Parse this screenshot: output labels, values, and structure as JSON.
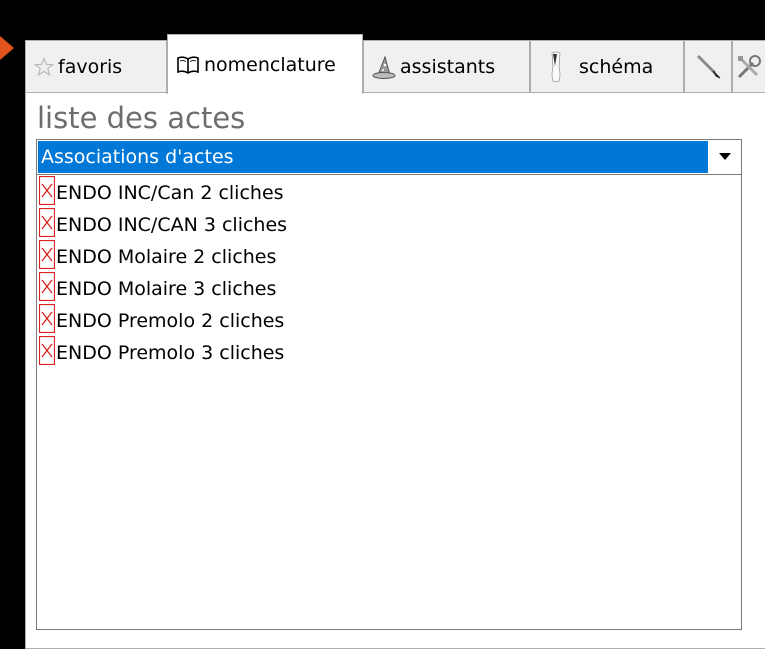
{
  "tabs": [
    {
      "label": "favoris",
      "icon": "star-icon"
    },
    {
      "label": "nomenclature",
      "icon": "book-icon",
      "active": true
    },
    {
      "label": "assistants",
      "icon": "wizard-hat-icon"
    },
    {
      "label": "schéma",
      "icon": "tooth-icon"
    },
    {
      "label": "",
      "icon": "pen-icon"
    },
    {
      "label": "",
      "icon": "tools-icon"
    }
  ],
  "section_title": "liste des actes",
  "combo": {
    "selected": "Associations d'actes"
  },
  "acts": [
    {
      "label": "ENDO INC/Can 2 cliches",
      "icon": "broken-image-icon"
    },
    {
      "label": "ENDO INC/CAN 3 cliches",
      "icon": "broken-image-icon"
    },
    {
      "label": "ENDO Molaire 2 cliches",
      "icon": "broken-image-icon"
    },
    {
      "label": "ENDO Molaire 3 cliches",
      "icon": "broken-image-icon"
    },
    {
      "label": "ENDO Premolo 2 cliches",
      "icon": "broken-image-icon"
    },
    {
      "label": "ENDO Premolo 3 cliches",
      "icon": "broken-image-icon"
    }
  ],
  "colors": {
    "selection": "#0078d7",
    "accent_arrow": "#e2541b",
    "broken_icon": "#e02020"
  }
}
